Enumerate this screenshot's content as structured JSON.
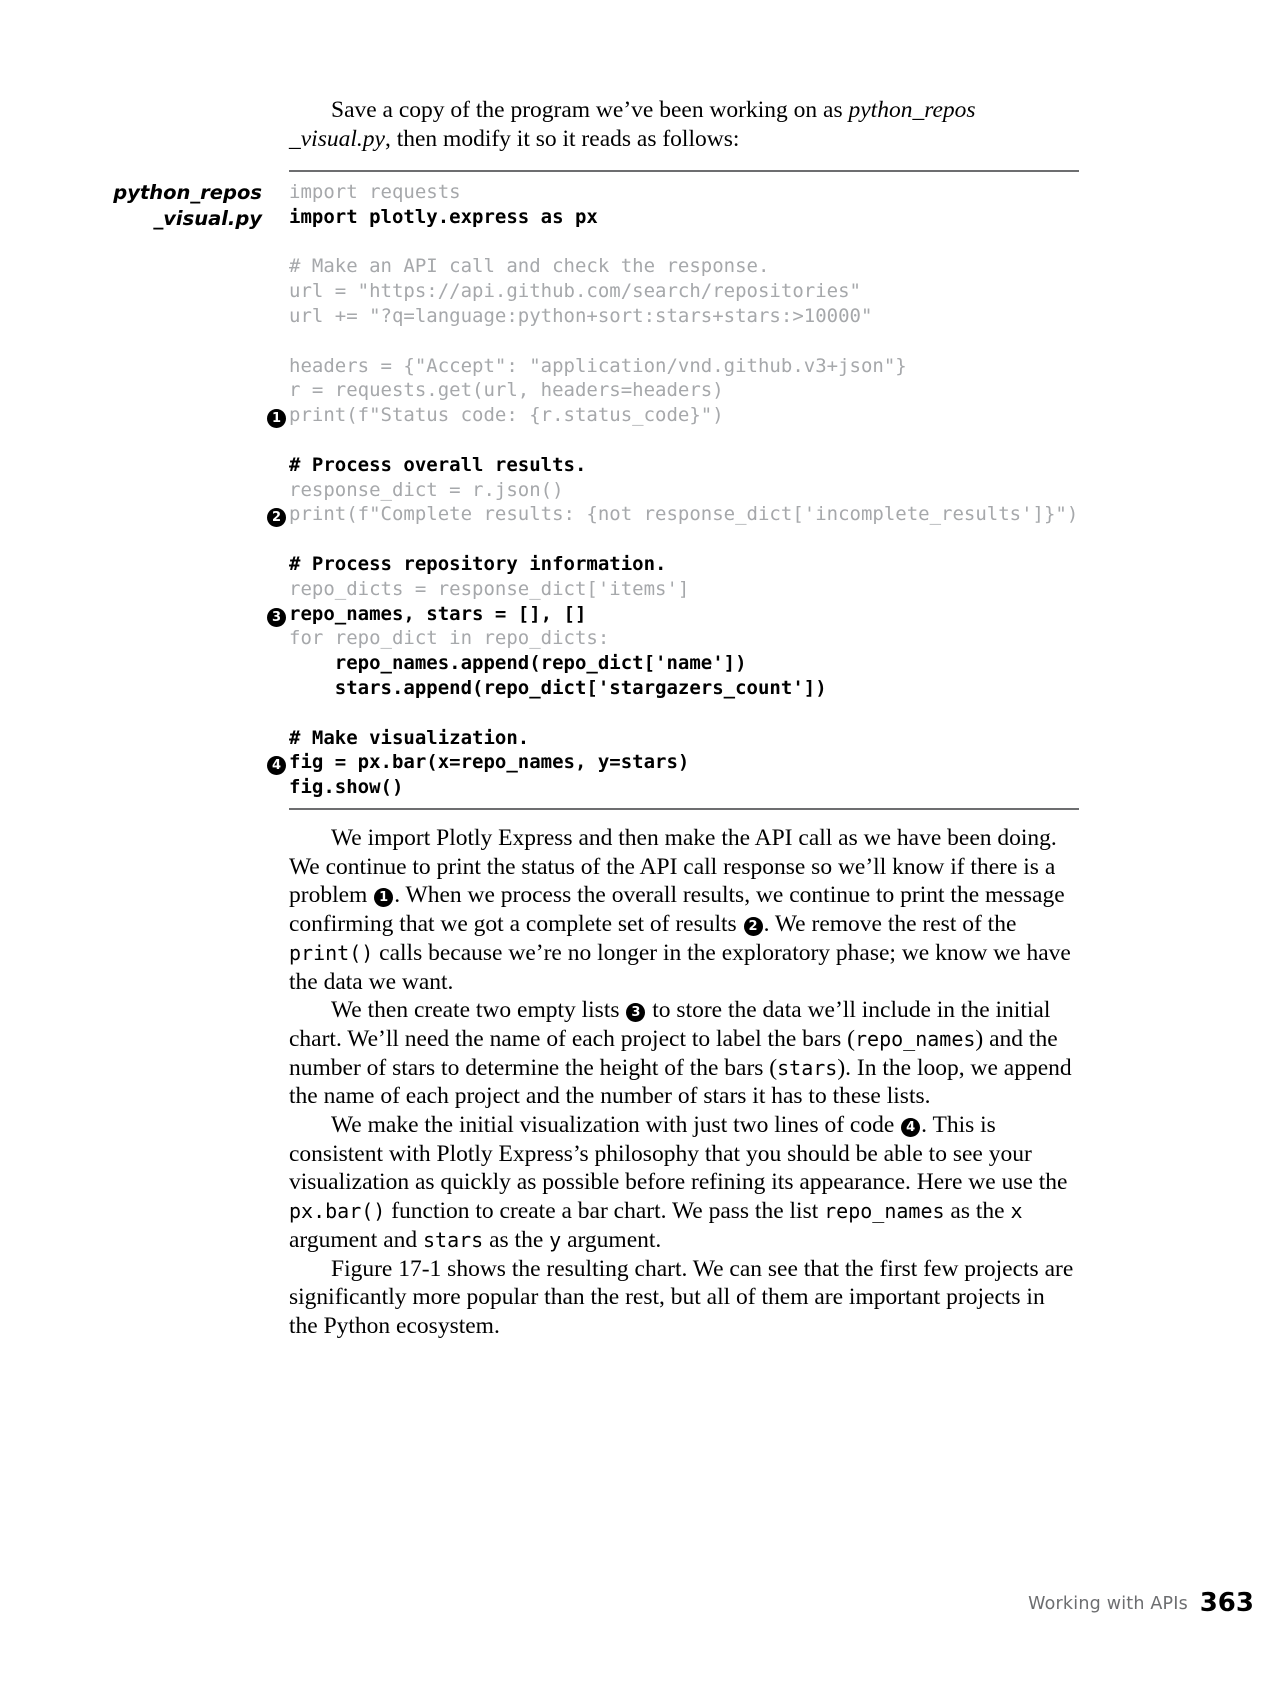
{
  "intro": {
    "lead_sentence_part1": "Save a copy of the program we’ve been working on as ",
    "filename_italic": "python_repos\n_visual.py",
    "lead_sentence_part2": ", then modify it so it reads as follows:"
  },
  "code": {
    "file_label_line1": "python_repos",
    "file_label_line2": "_visual.py",
    "lines": [
      {
        "marker": "",
        "text": "import requests",
        "style": "dim"
      },
      {
        "marker": "",
        "text": "import plotly.express as px",
        "style": "bold"
      },
      {
        "marker": "",
        "text": "",
        "style": "dim"
      },
      {
        "marker": "",
        "text": "# Make an API call and check the response.",
        "style": "dim"
      },
      {
        "marker": "",
        "text": "url = \"https://api.github.com/search/repositories\"",
        "style": "dim"
      },
      {
        "marker": "",
        "text": "url += \"?q=language:python+sort:stars+stars:>10000\"",
        "style": "dim"
      },
      {
        "marker": "",
        "text": "",
        "style": "dim"
      },
      {
        "marker": "",
        "text": "headers = {\"Accept\": \"application/vnd.github.v3+json\"}",
        "style": "dim"
      },
      {
        "marker": "",
        "text": "r = requests.get(url, headers=headers)",
        "style": "dim"
      },
      {
        "marker": "1",
        "text": "print(f\"Status code: {r.status_code}\")",
        "style": "dim"
      },
      {
        "marker": "",
        "text": "",
        "style": "dim"
      },
      {
        "marker": "",
        "text": "# Process overall results.",
        "style": "bold"
      },
      {
        "marker": "",
        "text": "response_dict = r.json()",
        "style": "dim"
      },
      {
        "marker": "2",
        "text": "print(f\"Complete results: {not response_dict['incomplete_results']}\")",
        "style": "dim"
      },
      {
        "marker": "",
        "text": "",
        "style": "dim"
      },
      {
        "marker": "",
        "text": "# Process repository information.",
        "style": "bold"
      },
      {
        "marker": "",
        "text": "repo_dicts = response_dict['items']",
        "style": "dim"
      },
      {
        "marker": "3",
        "text": "repo_names, stars = [], []",
        "style": "bold"
      },
      {
        "marker": "",
        "text": "for repo_dict in repo_dicts:",
        "style": "dim"
      },
      {
        "marker": "",
        "text": "    repo_names.append(repo_dict['name'])",
        "style": "bold"
      },
      {
        "marker": "",
        "text": "    stars.append(repo_dict['stargazers_count'])",
        "style": "bold"
      },
      {
        "marker": "",
        "text": "",
        "style": "dim"
      },
      {
        "marker": "",
        "text": "# Make visualization.",
        "style": "bold"
      },
      {
        "marker": "4",
        "text": "fig = px.bar(x=repo_names, y=stars)",
        "style": "bold"
      },
      {
        "marker": "",
        "text": "fig.show()",
        "style": "bold"
      }
    ]
  },
  "body": {
    "p1_a": "We import Plotly Express and then make the API call as we have been doing. We continue to print the status of the API call response so we’ll know if there is a problem ",
    "p1_marker1": "1",
    "p1_b": ". When we process the overall results, we continue to print the message confirming that we got a complete set of results ",
    "p1_marker2": "2",
    "p1_c": ". We remove the rest of the ",
    "p1_code1": "print()",
    "p1_d": " calls because we’re no longer in the exploratory phase; we know we have the data we want.",
    "p2_a": "We then create two empty lists ",
    "p2_marker3": "3",
    "p2_b": " to store the data we’ll include in the initial chart. We’ll need the name of each project to label the bars (",
    "p2_code1": "repo_names",
    "p2_c": ") and the number of stars to determine the height of the bars (",
    "p2_code2": "stars",
    "p2_d": "). In the loop, we append the name of each project and the number of stars it has to these lists.",
    "p3_a": "We make the initial visualization with just two lines of code ",
    "p3_marker4": "4",
    "p3_b": ". This is consistent with Plotly Express’s philosophy that you should be able to see your visualization as quickly as possible before refining its appearance. Here we use the ",
    "p3_code1": "px.bar()",
    "p3_c": " function to create a bar chart. We pass the list ",
    "p3_code2": "repo_names",
    "p3_d": " as the ",
    "p3_code3": "x",
    "p3_e": " argument and ",
    "p3_code4": "stars",
    "p3_f": " as the ",
    "p3_code5": "y",
    "p3_g": " argument.",
    "p4": "Figure 17-1 shows the resulting chart. We can see that the first few projects are significantly more popular than the rest, but all of them are important projects in the Python ecosystem."
  },
  "footer": {
    "chapter": "Working with APIs",
    "page_number": "363"
  },
  "colors": {
    "dim_code": "#a6a8ab",
    "rule": "#6d6e70",
    "text": "#000000",
    "footer_text": "#6d6e70"
  }
}
